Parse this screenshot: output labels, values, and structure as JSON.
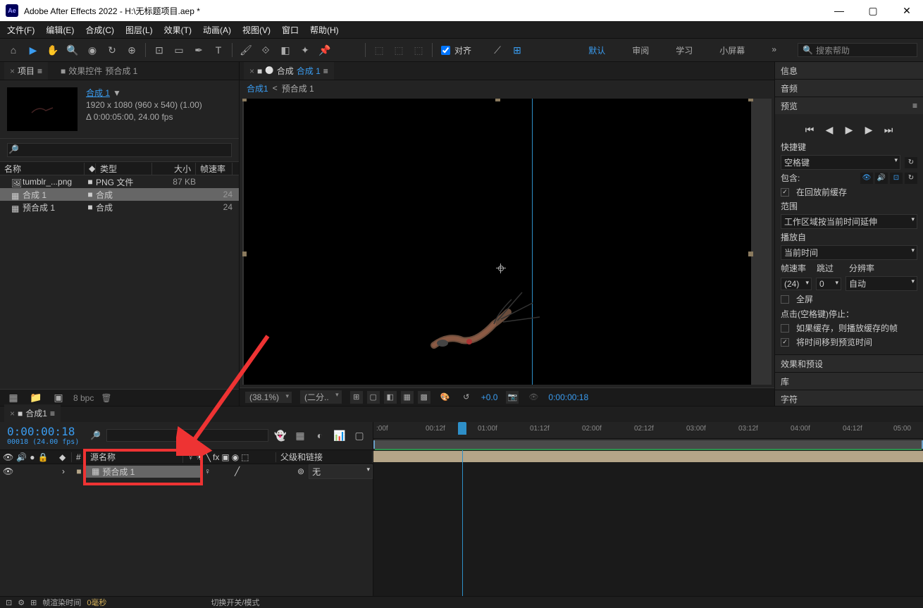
{
  "title_bar": {
    "app_icon": "Ae",
    "title": "Adobe After Effects 2022 - H:\\无标题项目.aep *",
    "min": "—",
    "max": "▢",
    "close": "✕"
  },
  "menu": {
    "items": [
      "文件(F)",
      "编辑(E)",
      "合成(C)",
      "图层(L)",
      "效果(T)",
      "动画(A)",
      "视图(V)",
      "窗口",
      "帮助(H)"
    ]
  },
  "toolbar": {
    "align_label": "对齐",
    "workspaces": [
      "默认",
      "审阅",
      "学习",
      "小屏幕"
    ],
    "overflow": "»",
    "search_placeholder": "搜索帮助",
    "search_icon": "🔍"
  },
  "project_panel": {
    "tab1": "项目",
    "tab2_pre": "效果控件 ",
    "tab2_name": "预合成 1",
    "info": {
      "name": "合成 1",
      "arrow": "▼",
      "res": "1920 x 1080  (960 x 540) (1.00)",
      "dur": "Δ 0:00:05:00, 24.00 fps"
    },
    "search_icon": "🔎",
    "headers": {
      "name": "名称",
      "type": "类型",
      "size": "大小",
      "fps": "帧速率"
    },
    "items": [
      {
        "icon": "🖼",
        "name": "tumblr_...png",
        "type": "PNG 文件",
        "size": "87 KB",
        "fps": "",
        "selected": false
      },
      {
        "icon": "▦",
        "name": "合成 1",
        "type": "合成",
        "size": "",
        "fps": "24",
        "selected": true
      },
      {
        "icon": "▦",
        "name": "预合成 1",
        "type": "合成",
        "size": "",
        "fps": "24",
        "selected": false
      }
    ],
    "footer": {
      "bpc": "8 bpc",
      "trash": "🗑"
    }
  },
  "viewer": {
    "tab_pre": "合成 ",
    "tab_name": "合成 1",
    "breadcrumb": {
      "active": "合成1",
      "sep": "<",
      "next": "预合成 1"
    },
    "footer": {
      "zoom": "(38.1%)",
      "res": "(二分..",
      "exposure": "+0.0",
      "timecode": "0:00:00:18"
    }
  },
  "right_panel": {
    "info": "信息",
    "audio": "音频",
    "preview": {
      "title": "预览",
      "shortcut_label": "快捷键",
      "shortcut_value": "空格键",
      "include_label": "包含:",
      "cache_before": "在回放前缓存",
      "range_label": "范围",
      "range_value": "工作区域按当前时间延伸",
      "playfrom_label": "播放自",
      "playfrom_value": "当前时间",
      "fps_label": "帧速率",
      "skip_label": "跳过",
      "res_label": "分辨率",
      "fps_value": "(24)",
      "skip_value": "0",
      "res_value": "自动",
      "fullscreen": "全屏",
      "stop_label": "点击(空格键)停止：",
      "if_cached": "如果缓存，则播放缓存的帧",
      "move_time": "将时间移到预览时间"
    },
    "effects": "效果和预设",
    "library": "库",
    "char": "字符"
  },
  "timeline": {
    "tab": "合成1",
    "timecode": "0:00:00:18",
    "timecode_sub": "00018 (24.00 fps)",
    "ruler": [
      ":00f",
      "00:12f",
      "01:00f",
      "01:12f",
      "02:00f",
      "02:12f",
      "03:00f",
      "03:12f",
      "04:00f",
      "04:12f",
      "05:00"
    ],
    "cols": {
      "source": "源名称",
      "parent": "父级和链接"
    },
    "layer": {
      "name": "预合成 1",
      "parent_value": "无"
    }
  },
  "status": {
    "render_label": "帧渲染时间",
    "render_value": "0毫秒",
    "switch_label": "切换开关/模式"
  }
}
